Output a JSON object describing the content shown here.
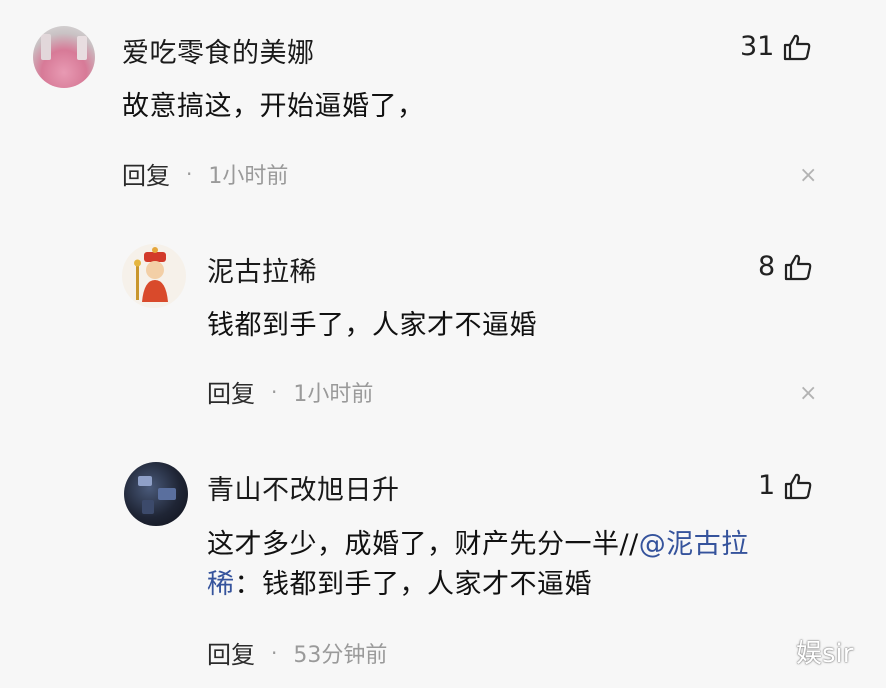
{
  "comments": [
    {
      "user": "爱吃零食的美娜",
      "text": "故意搞这，开始逼婚了，",
      "likes": "31",
      "reply_label": "回复",
      "separator": "·",
      "time": "1小时前",
      "avatar_icon": "pink-food-avatar-icon"
    },
    {
      "user": "泥古拉稀",
      "text": "钱都到手了，人家才不逼婚",
      "likes": "8",
      "reply_label": "回复",
      "separator": "·",
      "time": "1小时前",
      "avatar_icon": "cartoon-figure-avatar-icon"
    },
    {
      "user": "青山不改旭日升",
      "text_line1_plain": "这才多少，成婚了，财产先分一半//",
      "text_line1_mention": "@泥古拉",
      "text_line2_mention": "稀",
      "text_line2_plain": "：钱都到手了，人家才不逼婚",
      "likes": "1",
      "reply_label": "回复",
      "separator": "·",
      "time": "53分钟前",
      "avatar_icon": "dark-photo-avatar-icon"
    }
  ],
  "close_symbol": "×",
  "watermark": "娱sir",
  "colors": {
    "background": "#f7f7f7",
    "mention": "#35539c",
    "muted": "#9a9a9a"
  }
}
